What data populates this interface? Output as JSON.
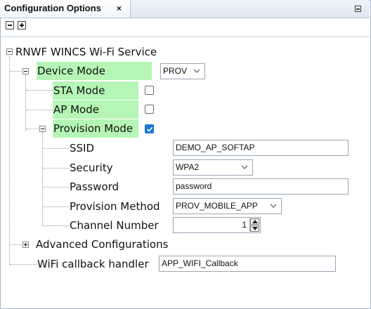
{
  "window": {
    "tab_title": "Configuration Options",
    "tab_close": "×"
  },
  "tree": {
    "root_label": "RNWF WINCS Wi-Fi Service",
    "device_mode": {
      "label": "Device Mode",
      "value": "PROV"
    },
    "sta_mode": {
      "label": "STA Mode",
      "checked": false
    },
    "ap_mode": {
      "label": "AP Mode",
      "checked": false
    },
    "provision_mode": {
      "label": "Provision Mode",
      "checked": true,
      "ssid": {
        "label": "SSID",
        "value": "DEMO_AP_SOFTAP"
      },
      "security": {
        "label": "Security",
        "value": "WPA2"
      },
      "password": {
        "label": "Password",
        "value": "password"
      },
      "provision_method": {
        "label": "Provision Method",
        "value": "PROV_MOBILE_APP"
      },
      "channel_number": {
        "label": "Channel Number",
        "value": "1"
      }
    },
    "advanced": {
      "label": "Advanced Configurations"
    },
    "callback": {
      "label": "WiFi callback handler",
      "value": "APP_WIFI_Callback"
    }
  },
  "colors": {
    "highlight": "#b5f5b5",
    "checkbox_checked": "#1e74d2"
  }
}
